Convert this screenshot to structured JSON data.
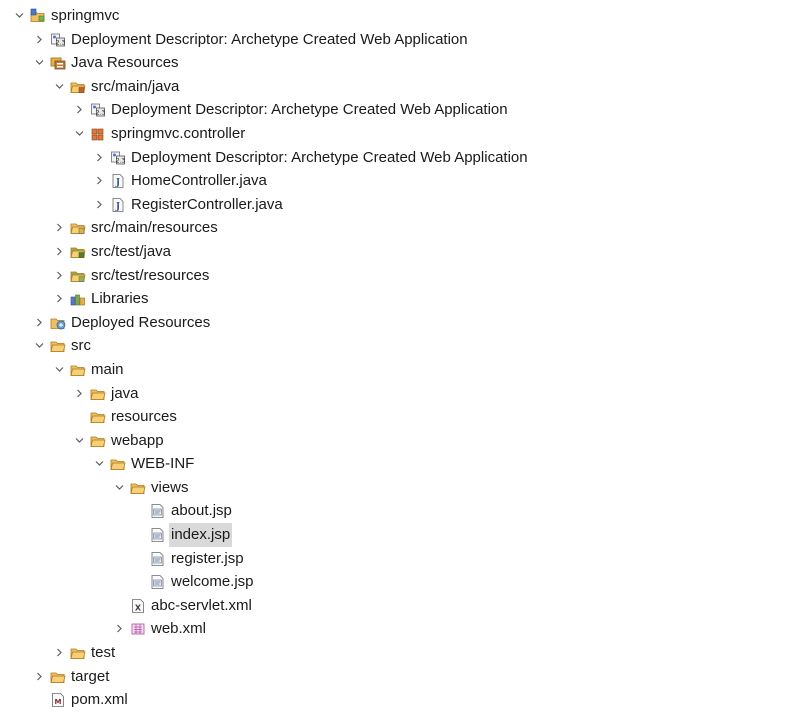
{
  "tree": [
    {
      "depth": 0,
      "state": "expanded",
      "icon": "project-icon",
      "label": "springmvc"
    },
    {
      "depth": 1,
      "state": "collapsed",
      "icon": "deployment-descriptor-icon",
      "label": "Deployment Descriptor: Archetype Created Web Application"
    },
    {
      "depth": 1,
      "state": "expanded",
      "icon": "java-resources-icon",
      "label": "Java Resources"
    },
    {
      "depth": 2,
      "state": "expanded",
      "icon": "source-folder-icon",
      "label": "src/main/java"
    },
    {
      "depth": 3,
      "state": "collapsed",
      "icon": "deployment-descriptor-icon",
      "label": "Deployment Descriptor: Archetype Created Web Application"
    },
    {
      "depth": 3,
      "state": "expanded",
      "icon": "package-icon",
      "label": "springmvc.controller"
    },
    {
      "depth": 4,
      "state": "collapsed",
      "icon": "deployment-descriptor-icon",
      "label": "Deployment Descriptor: Archetype Created Web Application"
    },
    {
      "depth": 4,
      "state": "collapsed",
      "icon": "java-file-icon",
      "label": "HomeController.java"
    },
    {
      "depth": 4,
      "state": "collapsed",
      "icon": "java-file-icon",
      "label": "RegisterController.java"
    },
    {
      "depth": 2,
      "state": "collapsed",
      "icon": "resource-folder-icon",
      "label": "src/main/resources"
    },
    {
      "depth": 2,
      "state": "collapsed",
      "icon": "test-source-folder-icon",
      "label": "src/test/java"
    },
    {
      "depth": 2,
      "state": "collapsed",
      "icon": "test-resource-folder-icon",
      "label": "src/test/resources"
    },
    {
      "depth": 2,
      "state": "collapsed",
      "icon": "libraries-icon",
      "label": "Libraries"
    },
    {
      "depth": 1,
      "state": "collapsed",
      "icon": "deployed-resources-icon",
      "label": "Deployed Resources"
    },
    {
      "depth": 1,
      "state": "expanded",
      "icon": "folder-open-icon",
      "label": "src"
    },
    {
      "depth": 2,
      "state": "expanded",
      "icon": "folder-open-icon",
      "label": "main"
    },
    {
      "depth": 3,
      "state": "collapsed",
      "icon": "folder-open-icon",
      "label": "java"
    },
    {
      "depth": 3,
      "state": "none",
      "icon": "folder-open-icon",
      "label": "resources"
    },
    {
      "depth": 3,
      "state": "expanded",
      "icon": "folder-open-icon",
      "label": "webapp"
    },
    {
      "depth": 4,
      "state": "expanded",
      "icon": "folder-open-icon",
      "label": "WEB-INF"
    },
    {
      "depth": 5,
      "state": "expanded",
      "icon": "folder-open-icon",
      "label": "views"
    },
    {
      "depth": 6,
      "state": "none",
      "icon": "jsp-file-icon",
      "label": "about.jsp"
    },
    {
      "depth": 6,
      "state": "none",
      "icon": "jsp-file-icon",
      "label": "index.jsp",
      "selected": true
    },
    {
      "depth": 6,
      "state": "none",
      "icon": "jsp-file-icon",
      "label": "register.jsp"
    },
    {
      "depth": 6,
      "state": "none",
      "icon": "jsp-file-icon",
      "label": "welcome.jsp"
    },
    {
      "depth": 5,
      "state": "none",
      "icon": "xml-file-icon",
      "label": "abc-servlet.xml"
    },
    {
      "depth": 5,
      "state": "collapsed",
      "icon": "web-xml-icon",
      "label": "web.xml"
    },
    {
      "depth": 2,
      "state": "collapsed",
      "icon": "folder-open-icon",
      "label": "test"
    },
    {
      "depth": 1,
      "state": "collapsed",
      "icon": "folder-open-icon",
      "label": "target"
    },
    {
      "depth": 1,
      "state": "none",
      "icon": "maven-pom-icon",
      "label": "pom.xml"
    }
  ],
  "colors": {
    "selection": "#d9d9d9",
    "folder": "#e8b04a",
    "folder_stroke": "#b07a1c",
    "package": "#c0642c",
    "twisty": "#5a5a5a"
  }
}
